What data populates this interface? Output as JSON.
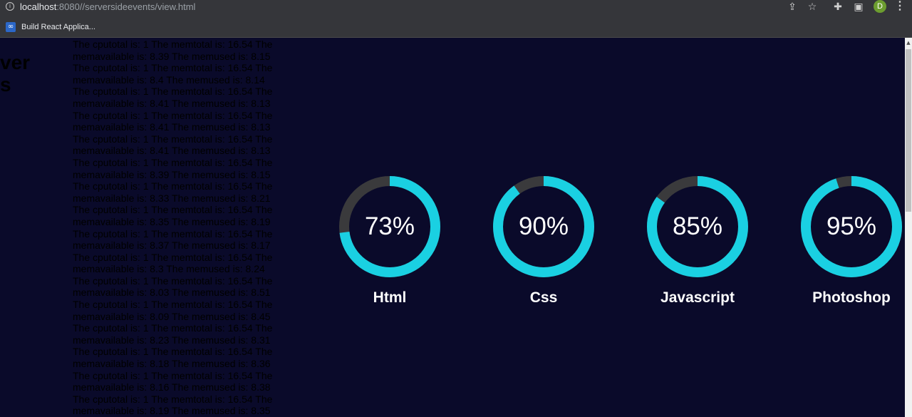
{
  "browser": {
    "url_host": "localhost",
    "url_path": ":8080//serversideevents/view.html",
    "avatar_letter": "D",
    "icons": [
      "info-icon",
      "share-icon",
      "star-icon",
      "extensions-icon",
      "sidepanel-icon",
      "kebab-menu-icon"
    ],
    "bookmark": {
      "label": "Build React Applica...",
      "icon": "infinity-icon"
    }
  },
  "page": {
    "heading": "server\ns",
    "log_lines": [
      "The cputotal is: 1 The memtotal is: 16.54 The memavailable is: 8.39 The memused is: 8.15",
      "The cputotal is: 1 The memtotal is: 16.54 The memavailable is: 8.4 The memused is: 8.14",
      "The cputotal is: 1 The memtotal is: 16.54 The memavailable is: 8.41 The memused is: 8.13",
      "The cputotal is: 1 The memtotal is: 16.54 The memavailable is: 8.41 The memused is: 8.13",
      "The cputotal is: 1 The memtotal is: 16.54 The memavailable is: 8.41 The memused is: 8.13",
      "The cputotal is: 1 The memtotal is: 16.54 The memavailable is: 8.39 The memused is: 8.15",
      "The cputotal is: 1 The memtotal is: 16.54 The memavailable is: 8.33 The memused is: 8.21",
      "The cputotal is: 1 The memtotal is: 16.54 The memavailable is: 8.35 The memused is: 8.19",
      "The cputotal is: 1 The memtotal is: 16.54 The memavailable is: 8.37 The memused is: 8.17",
      "The cputotal is: 1 The memtotal is: 16.54 The memavailable is: 8.3 The memused is: 8.24",
      "The cputotal is: 1 The memtotal is: 16.54 The memavailable is: 8.03 The memused is: 8.51",
      "The cputotal is: 1 The memtotal is: 16.54 The memavailable is: 8.09 The memused is: 8.45",
      "The cputotal is: 1 The memtotal is: 16.54 The memavailable is: 8.23 The memused is: 8.31",
      "The cputotal is: 1 The memtotal is: 16.54 The memavailable is: 8.18 The memused is: 8.36",
      "The cputotal is: 1 The memtotal is: 16.54 The memavailable is: 8.16 The memused is: 8.38",
      "The cputotal is: 1 The memtotal is: 16.54 The memavailable is: 8.19 The memused is: 8.35"
    ],
    "skills": [
      {
        "name": "Html",
        "label": "73%",
        "value": 73
      },
      {
        "name": "Css",
        "label": "90%",
        "value": 90
      },
      {
        "name": "Javascript",
        "label": "85%",
        "value": 85
      },
      {
        "name": "Photoshop",
        "label": "95%",
        "value": 95
      }
    ]
  },
  "colors": {
    "page_bg": "#0a0a2a",
    "ring_fill": "#1ad0e2",
    "ring_track": "#3a3a3c",
    "log_text": "#000000"
  }
}
